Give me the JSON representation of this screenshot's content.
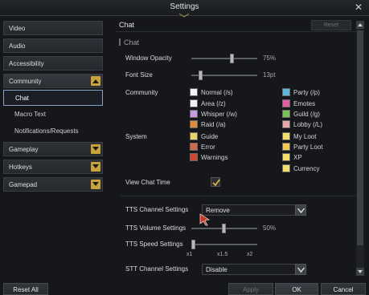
{
  "window": {
    "title": "Settings",
    "close_glyph": "✕"
  },
  "sidebar": {
    "items": [
      {
        "label": "Video"
      },
      {
        "label": "Audio"
      },
      {
        "label": "Accessibility"
      },
      {
        "label": "Community",
        "expanded": true
      },
      {
        "label": "Chat",
        "sub": true,
        "active": true
      },
      {
        "label": "Macro Text",
        "sub": true
      },
      {
        "label": "Notifications/Requests",
        "sub": true
      },
      {
        "label": "Gameplay"
      },
      {
        "label": "Hotkeys"
      },
      {
        "label": "Gamepad"
      }
    ]
  },
  "header": {
    "title": "Chat",
    "reset_label": "Reset"
  },
  "section": {
    "title": "Chat"
  },
  "window_opacity": {
    "label": "Window Opacity",
    "value_text": "75%",
    "value": 0.75
  },
  "font_size": {
    "label": "Font Size",
    "value_text": "13pt"
  },
  "community": {
    "label": "Community",
    "channels": [
      {
        "label": "Normal (/s)",
        "color": "#f2f2f2"
      },
      {
        "label": "Area (/z)",
        "color": "#f2f2f2"
      },
      {
        "label": "Whisper (/w)",
        "color": "#c79be0"
      },
      {
        "label": "Raid (/a)",
        "color": "#e08a3a"
      },
      {
        "label": "Party (/p)",
        "color": "#5fb7d7"
      },
      {
        "label": "Emotes",
        "color": "#e05fa0"
      },
      {
        "label": "Guild (/g)",
        "color": "#7ac25a"
      },
      {
        "label": "Lobby (/L)",
        "color": "#e6a8a8"
      }
    ]
  },
  "system": {
    "label": "System",
    "channels": [
      {
        "label": "Guide",
        "color": "#e8d36a"
      },
      {
        "label": "Error",
        "color": "#d46a4a"
      },
      {
        "label": "Warnings",
        "color": "#d2462f"
      },
      {
        "label": "My Loot",
        "color": "#f2e06c"
      },
      {
        "label": "Party Loot",
        "color": "#f2c75a"
      },
      {
        "label": "XP",
        "color": "#f2e06c"
      },
      {
        "label": "Currency",
        "color": "#f2e06c"
      }
    ]
  },
  "view_chat_time": {
    "label": "View Chat Time",
    "checked": true
  },
  "tts_channel": {
    "label": "TTS Channel Settings",
    "selected": "Remove"
  },
  "tts_volume": {
    "label": "TTS Volume Settings",
    "value_text": "50%",
    "value": 0.5
  },
  "tts_speed": {
    "label": "TTS Speed Settings",
    "ticks": [
      "x1",
      "x1.5",
      "x2"
    ]
  },
  "stt_channel": {
    "label": "STT Channel Settings",
    "selected": "Disable"
  },
  "footer": {
    "reset_all": "Reset All",
    "apply": "Apply",
    "ok": "OK",
    "cancel": "Cancel"
  },
  "colors": {
    "accent": "#c9a23a",
    "active_border": "#8aa0c4"
  }
}
